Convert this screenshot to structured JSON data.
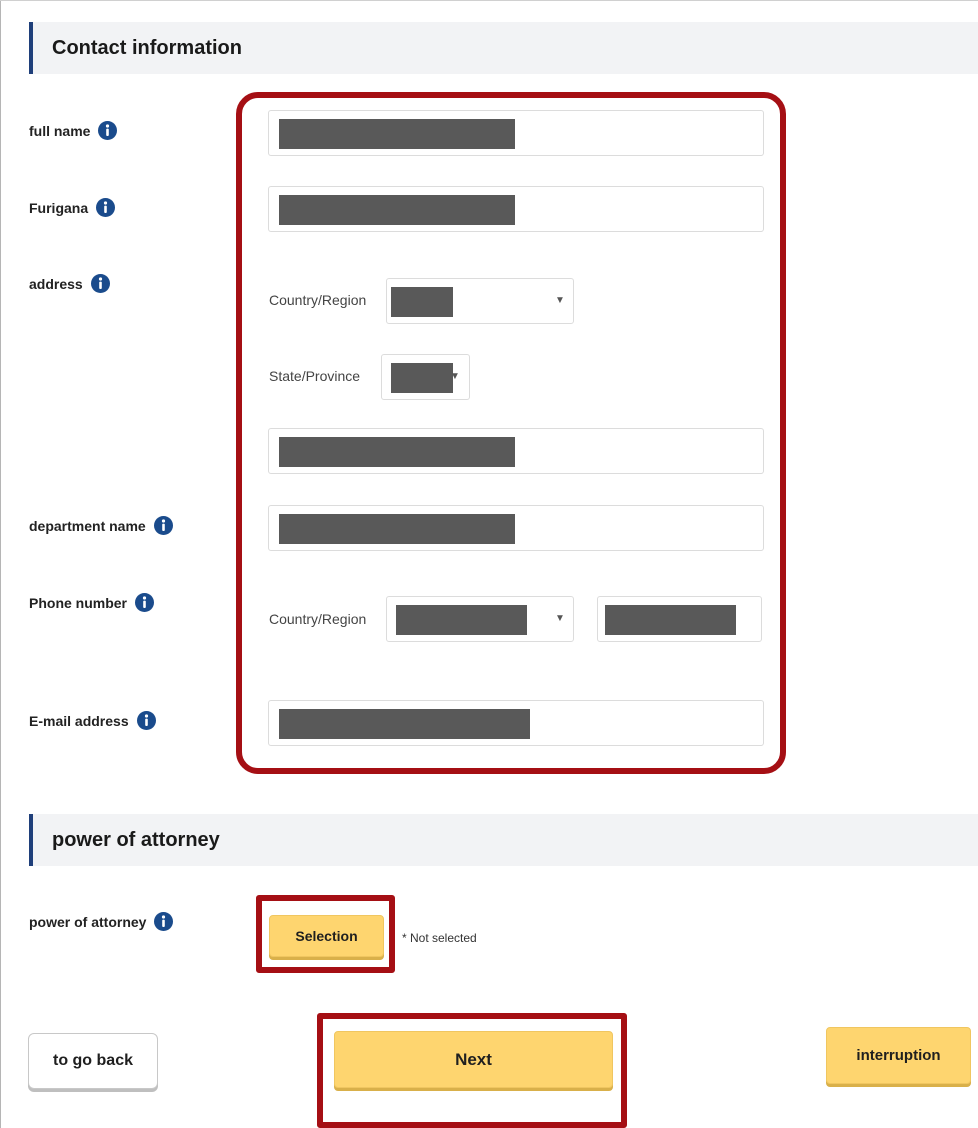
{
  "sections": {
    "contact": {
      "title": "Contact information"
    },
    "poa": {
      "title": "power of attorney"
    }
  },
  "fields": {
    "full_name": {
      "label": "full name"
    },
    "furigana": {
      "label": "Furigana"
    },
    "address": {
      "label": "address",
      "country_label": "Country/Region",
      "state_label": "State/Province"
    },
    "department": {
      "label": "department name"
    },
    "phone": {
      "label": "Phone number",
      "country_label": "Country/Region"
    },
    "email": {
      "label": "E-mail address"
    },
    "poa": {
      "label": "power of attorney",
      "button_label": "Selection",
      "status": "* Not selected"
    }
  },
  "icons": {
    "info": "info-icon",
    "dropdown": "caret-down-icon"
  },
  "buttons": {
    "back": "to go back",
    "next": "Next",
    "interrupt": "interruption"
  },
  "colors": {
    "accent_bar": "#1f3f7a",
    "info_icon": "#1a4b8c",
    "highlight": "#a50f14",
    "primary_button": "#fed56f",
    "redaction": "#595959"
  }
}
